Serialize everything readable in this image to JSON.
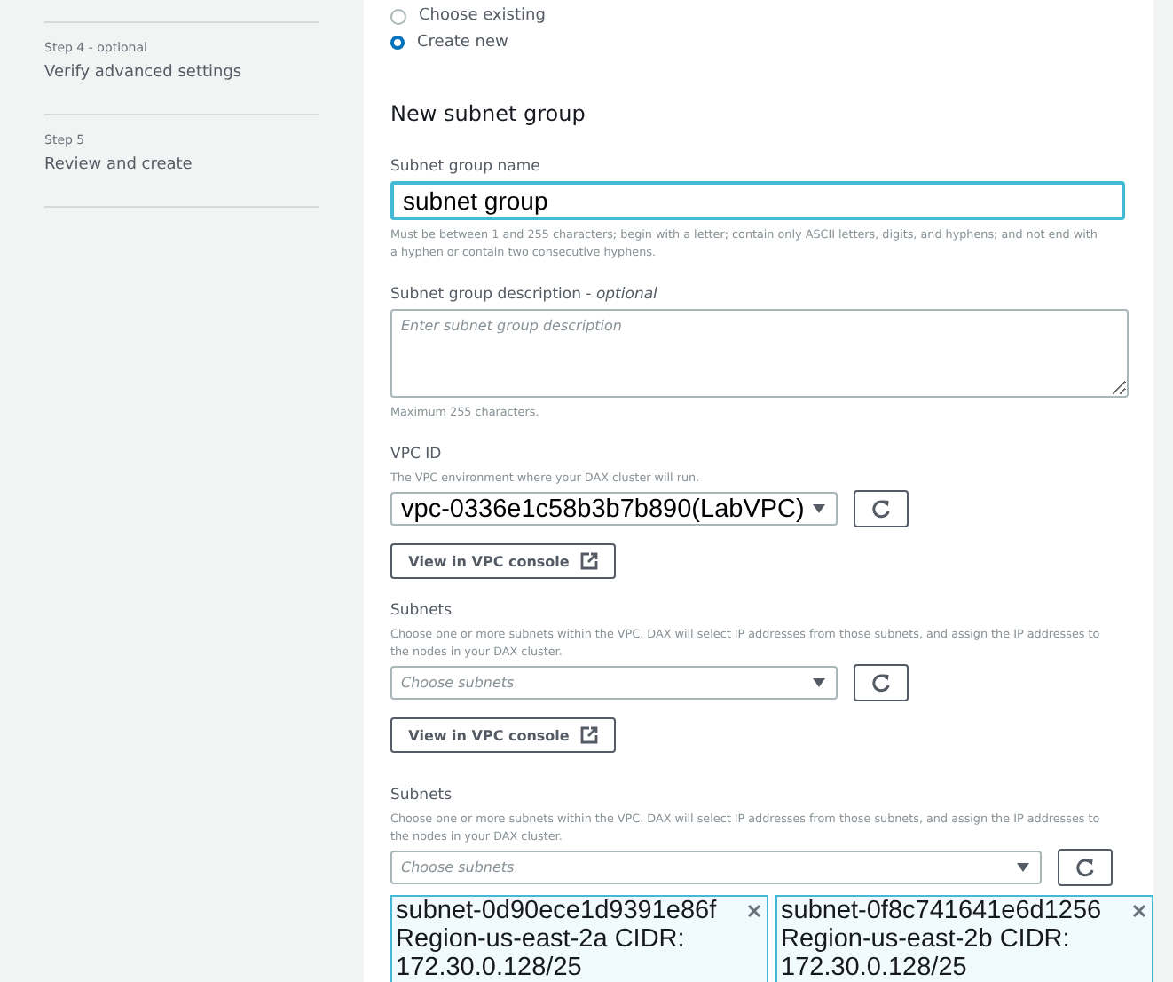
{
  "sidebar": {
    "steps": [
      {
        "step": "Step 4 - optional",
        "title": "Verify advanced settings"
      },
      {
        "step": "Step 5",
        "title": "Review and create"
      }
    ]
  },
  "subnet_group_options": [
    {
      "label": "Choose existing",
      "selected": false
    },
    {
      "label": "Create new",
      "selected": true
    }
  ],
  "new_subnet_group": {
    "heading": "New subnet group",
    "name_field": {
      "label": "Subnet group name",
      "value": "subnet group",
      "hint": "Must be between 1 and 255 characters; begin with a letter; contain only ASCII letters, digits, and hyphens; and not end with a hyphen or contain two consecutive hyphens."
    },
    "description_field": {
      "label": "Subnet group description - *optional*",
      "placeholder": "Enter subnet group description",
      "hint": "Maximum 255 characters."
    },
    "vpc": {
      "label": "VPC ID",
      "description": "The VPC environment where your DAX cluster will run.",
      "value": "vpc-0336e1c58b3b7b890(LabVPC)",
      "view_button": "View in VPC console"
    },
    "subnets": {
      "label": "Subnets",
      "description": "Choose one or more subnets within the VPC. DAX will select IP addresses from those subnets, and assign the IP addresses to the nodes in your DAX cluster.",
      "placeholder": "Choose subnets",
      "view_button": "View in VPC console"
    },
    "subnets_selected": {
      "label": "Subnets",
      "description": "Choose one or more subnets within the VPC. DAX will select IP addresses from those subnets, and assign the IP addresses to the nodes in your DAX cluster.",
      "placeholder": "Choose subnets",
      "tokens": [
        {
          "id": "subnet-0d90ece1d9391e86f",
          "details": "Region-us-east-2a CIDR: 172.30.0.128/25"
        },
        {
          "id": "subnet-0f8c741641e6d1256",
          "details": "Region-us-east-2b CIDR: 172.30.0.128/25"
        }
      ]
    }
  }
}
